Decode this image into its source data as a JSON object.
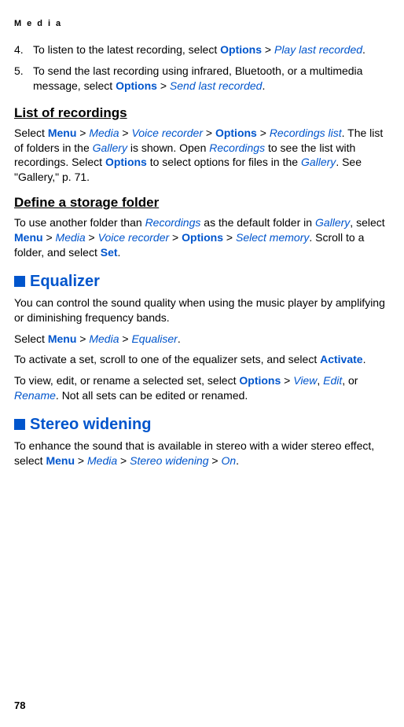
{
  "header": "Media",
  "pageNumber": "78",
  "item4": {
    "text1": "To listen to the latest recording, select ",
    "options": "Options",
    "gt": " > ",
    "playLast": "Play last recorded",
    "period": "."
  },
  "item5": {
    "text1": "To send the last recording using infrared, Bluetooth, or a multimedia message, select ",
    "options": "Options",
    "gt": " > ",
    "sendLast": "Send last recorded",
    "period": "."
  },
  "listOfRecordings": {
    "heading": "List of recordings",
    "t1": "Select ",
    "menu": "Menu",
    "gt1": " > ",
    "media": "Media",
    "gt2": " > ",
    "vr": "Voice recorder",
    "gt3": " > ",
    "options": "Options",
    "gt4": " > ",
    "rl": "Recordings list",
    "t2": ". The list of folders in the ",
    "gallery": "Gallery",
    "t3": " is shown. Open ",
    "recordings": "Recordings",
    "t4": " to see the list with recordings. Select ",
    "options2": "Options",
    "t5": " to select options for files in the ",
    "gallery2": "Gallery",
    "t6": ". See \"Gallery,\" p. 71."
  },
  "defineStorage": {
    "heading": "Define a storage folder",
    "t1": "To use another folder than ",
    "recordings": "Recordings",
    "t2": " as the default folder in ",
    "gallery": "Gallery",
    "t3": ", select ",
    "menu": "Menu",
    "gt1": " > ",
    "media": "Media",
    "gt2": " > ",
    "vr": "Voice recorder",
    "gt3": " > ",
    "options": "Options",
    "gt4": " > ",
    "sm": "Select memory",
    "t4": ". Scroll to a folder, and select ",
    "set": "Set",
    "period": "."
  },
  "equalizer": {
    "heading": "Equalizer",
    "p1": "You can control the sound quality when using the music player by amplifying or diminishing frequency bands.",
    "p2a": "Select ",
    "menu": "Menu",
    "gt1": " > ",
    "media": "Media",
    "gt2": " > ",
    "eq": "Equaliser",
    "p2b": ".",
    "p3a": "To activate a set, scroll to one of the equalizer sets, and select ",
    "activate": "Activate",
    "p3b": ".",
    "p4a": "To view, edit, or rename a selected set, select ",
    "options": "Options",
    "gt3": " > ",
    "view": "View",
    "comma": ", ",
    "edit": "Edit",
    "comma2": ", or ",
    "rename": "Rename",
    "p4b": ". Not all sets can be edited or renamed."
  },
  "stereo": {
    "heading": "Stereo widening",
    "t1": "To enhance the sound that is available in stereo with a wider stereo effect, select ",
    "menu": "Menu",
    "gt1": " > ",
    "media": "Media",
    "gt2": " > ",
    "sw": "Stereo widening",
    "gt3": " > ",
    "on": "On",
    "period": "."
  }
}
